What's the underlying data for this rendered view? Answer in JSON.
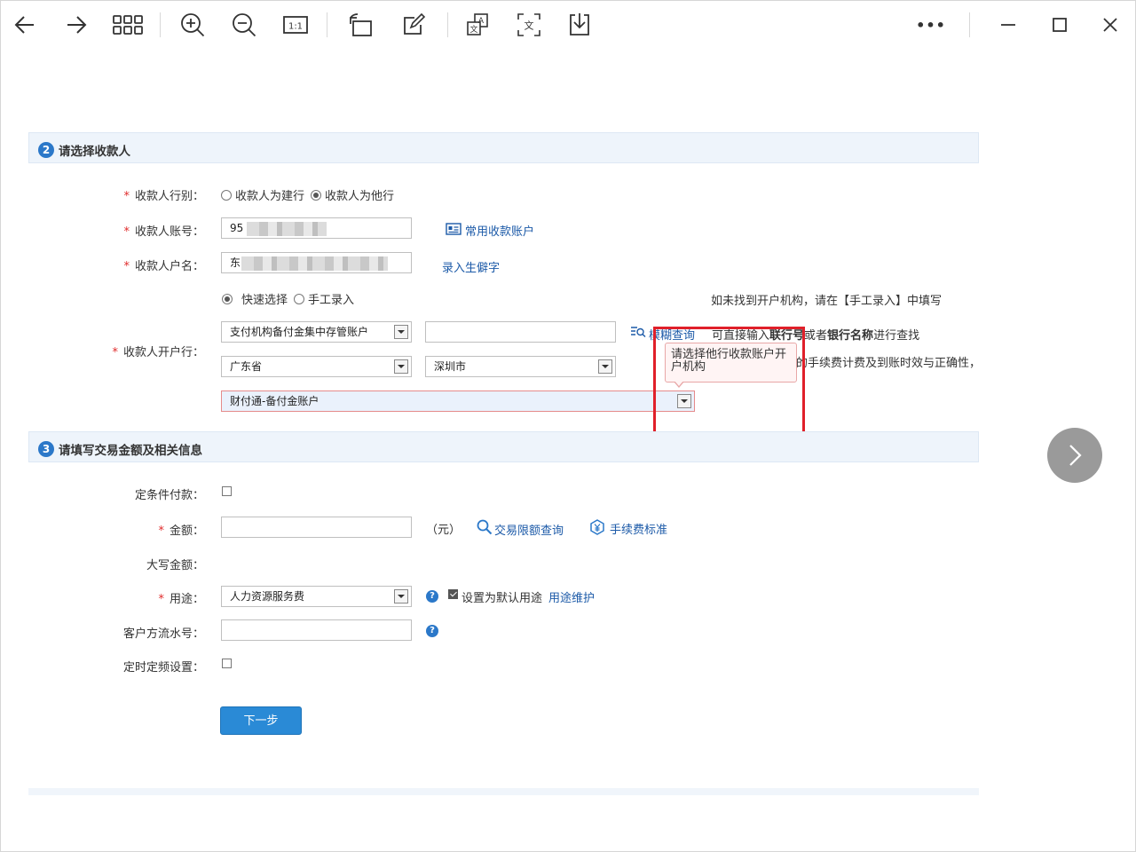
{
  "colors": {
    "accent": "#2b78c9",
    "link": "#1c5aa8",
    "error": "#e0202a",
    "button": "#2a8ad6"
  },
  "toolbar": {
    "left_icons": [
      "arrow-left-icon",
      "arrow-right-icon",
      "grid-icon",
      "zoom-in-icon",
      "zoom-out-icon",
      "actual-size-icon",
      "rotate-icon",
      "edit-icon",
      "translate-icon",
      "ocr-text-icon",
      "download-icon"
    ],
    "actual_size_glyph": "1:1",
    "ocr_glyph": "文",
    "translate_glyph_a": "A",
    "translate_glyph_b": "文",
    "more": "•••"
  },
  "section2": {
    "num": "2",
    "title": "请选择收款人",
    "bank_type": {
      "label": "收款人行别：",
      "opt_ccb": "收款人为建行",
      "opt_other": "收款人为他行",
      "selected": "other"
    },
    "account": {
      "label": "收款人账号：",
      "value": "95",
      "link": "常用收款账户"
    },
    "name": {
      "label": "收款人户名：",
      "value": "东",
      "link": "录入生僻字"
    },
    "mode": {
      "opt_quick": "快速选择",
      "opt_manual": "手工录入",
      "selected": "quick",
      "hint": "如未找到开户机构，请在【手工录入】中填写"
    },
    "bank": {
      "label": "收款人开户行：",
      "type_select": "支付机构备付金集中存管账户",
      "search_link": "模糊查询",
      "hint_pre": "可直接输入",
      "hint_bold1": "联行号",
      "hint_mid": "或者",
      "hint_bold2": "银行名称",
      "hint_post": "进行查找",
      "province": "广东省",
      "city": "深圳市",
      "hint2_visible": "的手续费计费及到账时效与正确性，",
      "institution": "财付通-备付金账户",
      "tooltip": "请选择他行收款账户开户机构"
    }
  },
  "section3": {
    "num": "3",
    "title": "请填写交易金额及相关信息",
    "conditional": {
      "label": "定条件付款："
    },
    "amount": {
      "label": "金额：",
      "unit": "（元）",
      "limit_link": "交易限额查询",
      "fee_link": "手续费标准"
    },
    "uppercase": {
      "label": "大写金额："
    },
    "purpose": {
      "label": "用途：",
      "value": "人力资源服务费",
      "default_label": "设置为默认用途",
      "maint_link": "用途维护"
    },
    "serial": {
      "label": "客户方流水号："
    },
    "schedule": {
      "label": "定时定频设置："
    },
    "next_button": "下一步"
  }
}
